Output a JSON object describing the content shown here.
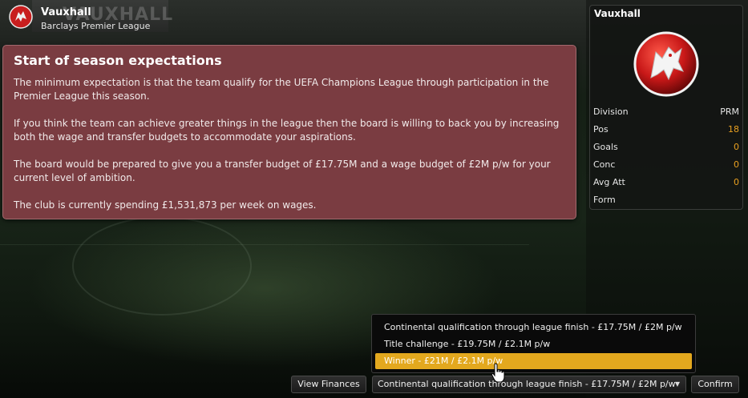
{
  "header": {
    "club_name": "Vauxhall",
    "league_name": "Barclays Premier League"
  },
  "background": {
    "wall_text": "VAUXHALL"
  },
  "expectations": {
    "title": "Start of season expectations",
    "paragraphs": [
      "The minimum expectation is that the team qualify for the UEFA Champions League through participation in the Premier League this season.",
      "If you think the team can achieve greater things in the league then the board is willing to back you by increasing both the wage and transfer budgets to accommodate your aspirations.",
      "The board would be prepared to give you a transfer budget of £17.75M and a wage budget of £2M p/w for your current level of ambition.",
      "The club is currently spending £1,531,873 per week on wages."
    ]
  },
  "sidebar": {
    "club_name": "Vauxhall",
    "stats": [
      {
        "label": "Division",
        "value": "PRM",
        "color": "#e6e6e6"
      },
      {
        "label": "Pos",
        "value": "18",
        "color": "#e8a020"
      },
      {
        "label": "Goals",
        "value": "0",
        "color": "#e8a020"
      },
      {
        "label": "Conc",
        "value": "0",
        "color": "#e8a020"
      },
      {
        "label": "Avg Att",
        "value": "0",
        "color": "#e8a020"
      },
      {
        "label": "Form",
        "value": "",
        "color": "#e6e6e6"
      }
    ]
  },
  "ambition_dropdown": {
    "options": [
      "Continental qualification through league finish - £17.75M / £2M p/w",
      "Title challenge - £19.75M / £2.1M p/w",
      "Winner - £21M / £2.1M p/w"
    ],
    "highlighted_index": 2,
    "selected_value": "Continental qualification through league finish - £17.75M / £2M p/w"
  },
  "buttons": {
    "view_finances": "View Finances",
    "confirm": "Confirm"
  },
  "colors": {
    "panel_bg": "#7a3c41",
    "highlight": "#e3a81e",
    "stat_accent": "#e8a020",
    "badge_red": "#d01f1f"
  },
  "icons": {
    "club_badge": "griffin-badge-icon",
    "dropdown_caret": "caret-down-icon",
    "cursor": "hand-cursor-icon"
  }
}
